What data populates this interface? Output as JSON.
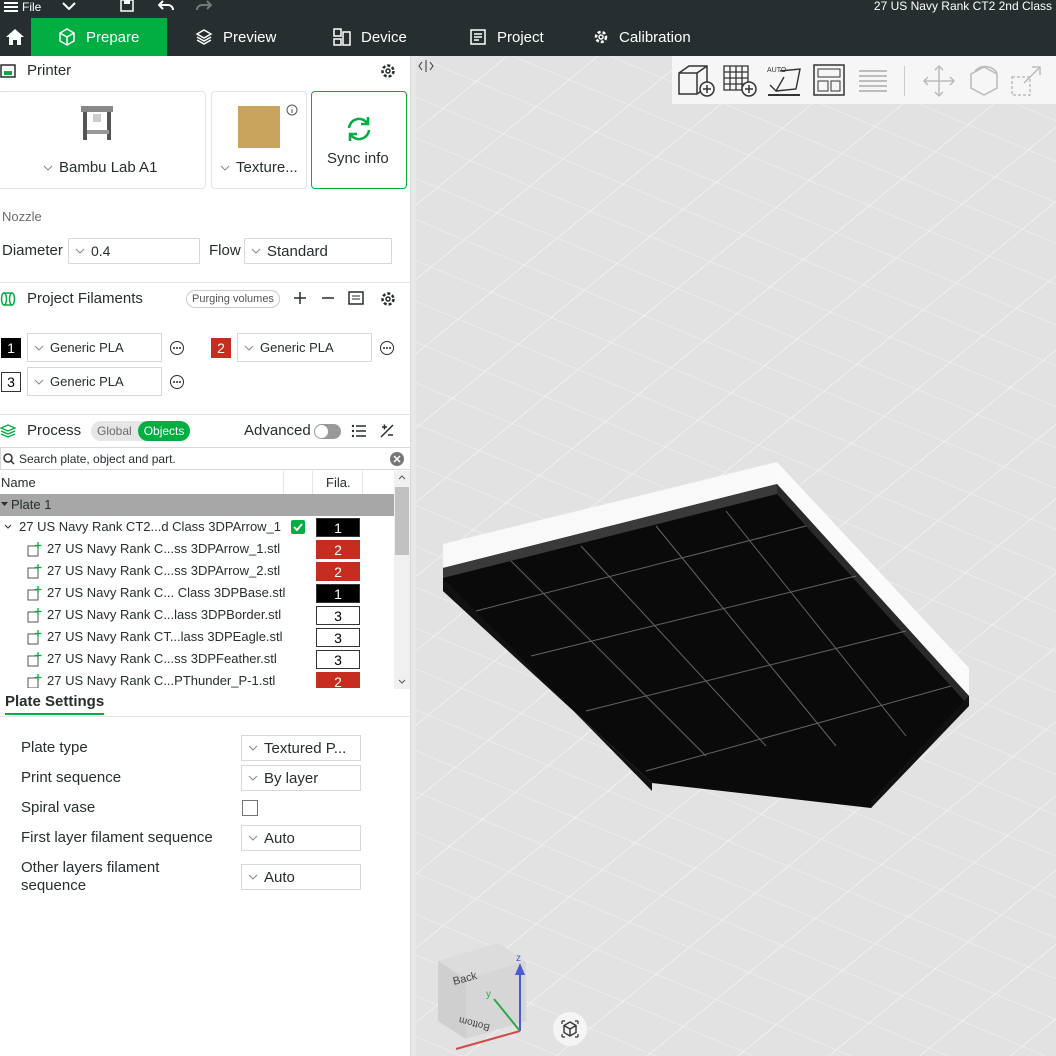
{
  "titlebar": {
    "file_label": "File",
    "title": "27 US Navy Rank CT2 2nd Class"
  },
  "nav": {
    "tabs": [
      {
        "label": "Prepare",
        "active": true
      },
      {
        "label": "Preview"
      },
      {
        "label": "Device"
      },
      {
        "label": "Project"
      },
      {
        "label": "Calibration"
      }
    ]
  },
  "printer": {
    "header": "Printer",
    "printer_name": "Bambu Lab A1",
    "plate_name": "Texture...",
    "sync_label": "Sync info",
    "nozzle_label": "Nozzle",
    "diameter_label": "Diameter",
    "diameter_value": "0.4",
    "flow_label": "Flow",
    "flow_value": "Standard"
  },
  "filaments": {
    "header": "Project Filaments",
    "purging_label": "Purging volumes",
    "items": [
      {
        "index": "1",
        "name": "Generic PLA",
        "color": "#000000"
      },
      {
        "index": "2",
        "name": "Generic PLA",
        "color": "#c62d1f"
      },
      {
        "index": "3",
        "name": "Generic PLA",
        "color": "#ffffff"
      }
    ]
  },
  "process": {
    "header": "Process",
    "global_label": "Global",
    "objects_label": "Objects",
    "advanced_label": "Advanced",
    "search_placeholder": "Search plate, object and part."
  },
  "tree": {
    "col_name": "Name",
    "col_fila": "Fila.",
    "plate_label": "Plate 1",
    "object": {
      "name": "27 US Navy Rank CT2...d Class 3DPArrow_1",
      "fila": "1",
      "color": "#000000"
    },
    "parts": [
      {
        "name": "27 US Navy Rank C...ss 3DPArrow_1.stl",
        "fila": "2",
        "color": "#c62d1f"
      },
      {
        "name": "27 US Navy Rank C...ss 3DPArrow_2.stl",
        "fila": "2",
        "color": "#c62d1f"
      },
      {
        "name": "27 US Navy Rank C... Class 3DPBase.stl",
        "fila": "1",
        "color": "#000000"
      },
      {
        "name": "27 US Navy Rank C...lass 3DPBorder.stl",
        "fila": "3",
        "color": "#ffffff"
      },
      {
        "name": "27 US Navy Rank CT...lass 3DPEagle.stl",
        "fila": "3",
        "color": "#ffffff"
      },
      {
        "name": "27 US Navy Rank C...ss 3DPFeather.stl",
        "fila": "3",
        "color": "#ffffff"
      },
      {
        "name": "27 US Navy Rank C...PThunder_P-1.stl",
        "fila": "2",
        "color": "#c62d1f"
      }
    ]
  },
  "plate_settings": {
    "tab_label": "Plate Settings",
    "plate_type_label": "Plate type",
    "plate_type_value": "Textured P...",
    "print_sequence_label": "Print sequence",
    "print_sequence_value": "By layer",
    "spiral_label": "Spiral vase",
    "spiral_checked": false,
    "first_layer_label": "First layer filament sequence",
    "first_layer_value": "Auto",
    "other_layers_label_1": "Other layers filament",
    "other_layers_label_2": "sequence",
    "other_layers_value": "Auto"
  },
  "viewport": {
    "toolbar_icons": [
      "add-cube-icon",
      "add-plate-icon",
      "auto-orient-icon",
      "arrange-icon",
      "layers-icon",
      "move-icon",
      "rotate-icon",
      "scale-icon"
    ],
    "nav_cube_labels": {
      "back": "Back",
      "bottom": "Bottom",
      "z": "z",
      "y": "y"
    },
    "colors": {
      "accent": "#00ae42",
      "model": "#0a0a0a",
      "bed": "#e5e5e5"
    }
  }
}
